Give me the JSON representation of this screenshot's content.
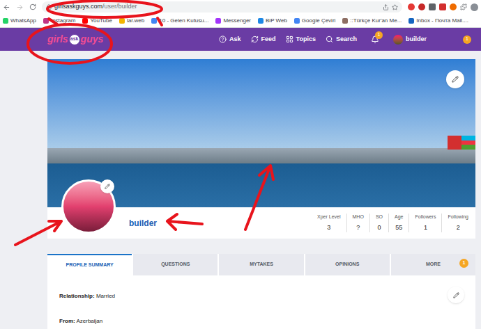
{
  "browser": {
    "url_host": "girlsaskguys.com",
    "url_path": "/user/builder",
    "bookmarks": [
      {
        "label": "WhatsApp",
        "color": "#25d366"
      },
      {
        "label": "Instagram",
        "color": "#c13584"
      },
      {
        "label": "YouTube",
        "color": "#ff0000"
      },
      {
        "label": "lar.web",
        "color": "#f4b400"
      },
      {
        "label": "10 - Gelen Kutusu...",
        "color": "#4285f4"
      },
      {
        "label": "Messenger",
        "color": "#a334fa"
      },
      {
        "label": "BiP Web",
        "color": "#1e88e5"
      },
      {
        "label": "Google Çeviri",
        "color": "#4285f4"
      },
      {
        "label": "::Türkçe Kur'an Me...",
        "color": "#8d6e63"
      },
      {
        "label": "Inbox - Почта Mail....",
        "color": "#1565c0"
      }
    ]
  },
  "nav": {
    "logo": [
      "girls",
      "ask",
      "guys"
    ],
    "items": [
      "Ask",
      "Feed",
      "Topics",
      "Search"
    ],
    "notification_count": "1",
    "user": "builder",
    "alert_count": "1"
  },
  "profile": {
    "name": "builder",
    "stats": [
      {
        "label": "Xper Level",
        "value": "3"
      },
      {
        "label": "MHO",
        "value": "?"
      },
      {
        "label": "SO",
        "value": "0"
      },
      {
        "label": "Age",
        "value": "55"
      },
      {
        "label": "Followers",
        "value": "1"
      },
      {
        "label": "Following",
        "value": "2"
      }
    ]
  },
  "tabs": [
    {
      "label": "PROFILE SUMMARY",
      "selected": true,
      "badge": ""
    },
    {
      "label": "QUESTIONS",
      "selected": false,
      "badge": ""
    },
    {
      "label": "MYTAKES",
      "selected": false,
      "badge": ""
    },
    {
      "label": "OPINIONS",
      "selected": false,
      "badge": ""
    },
    {
      "label": "MORE",
      "selected": false,
      "badge": "1"
    }
  ],
  "summary": [
    {
      "label": "Relationship:",
      "value": "Married"
    },
    {
      "label": "From:",
      "value": "Azerbaijan"
    }
  ]
}
